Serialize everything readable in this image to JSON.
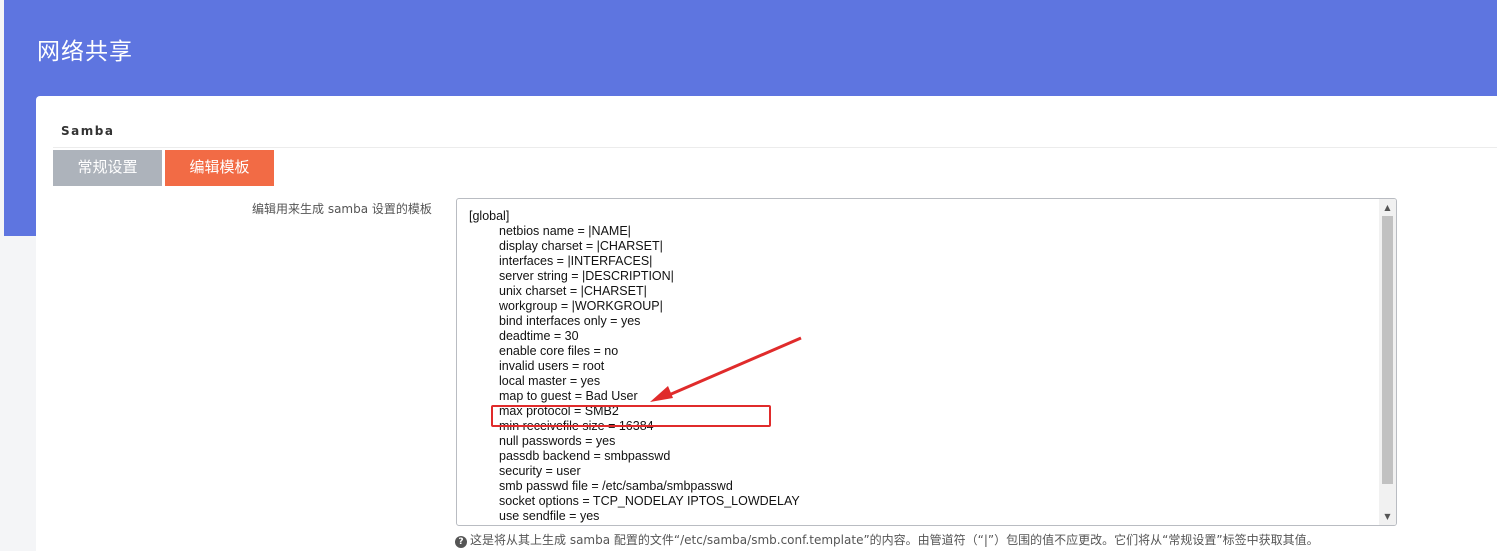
{
  "page": {
    "title": "网络共享"
  },
  "section": {
    "title": "Samba"
  },
  "tabs": [
    {
      "label": "常规设置",
      "active": false
    },
    {
      "label": "编辑模板",
      "active": true
    }
  ],
  "template": {
    "label": "编辑用来生成 samba 设置的模板",
    "lines": [
      "[global]",
      "netbios name = |NAME|",
      "display charset = |CHARSET|",
      "interfaces = |INTERFACES|",
      "server string = |DESCRIPTION|",
      "unix charset = |CHARSET|",
      "workgroup = |WORKGROUP|",
      "bind interfaces only = yes",
      "deadtime = 30",
      "enable core files = no",
      "invalid users = root",
      "local master = yes",
      "map to guest = Bad User",
      "max protocol = SMB2",
      "min receivefile size = 16384",
      "null passwords = yes",
      "passdb backend = smbpasswd",
      "security = user",
      "smb passwd file = /etc/samba/smbpasswd",
      "socket options = TCP_NODELAY IPTOS_LOWDELAY",
      "use sendfile = yes"
    ],
    "help": "这是将从其上生成 samba 配置的文件“/etc/samba/smb.conf.template”的内容。由管道符（“|”）包围的值不应更改。它们将从“常规设置”标签中获取其值。",
    "help_icon": "question-circle-icon"
  },
  "colors": {
    "header": "#5e75e0",
    "active_tab": "#f26b45",
    "inactive_tab": "#adb3bb",
    "annotation": "#e02b2b"
  }
}
